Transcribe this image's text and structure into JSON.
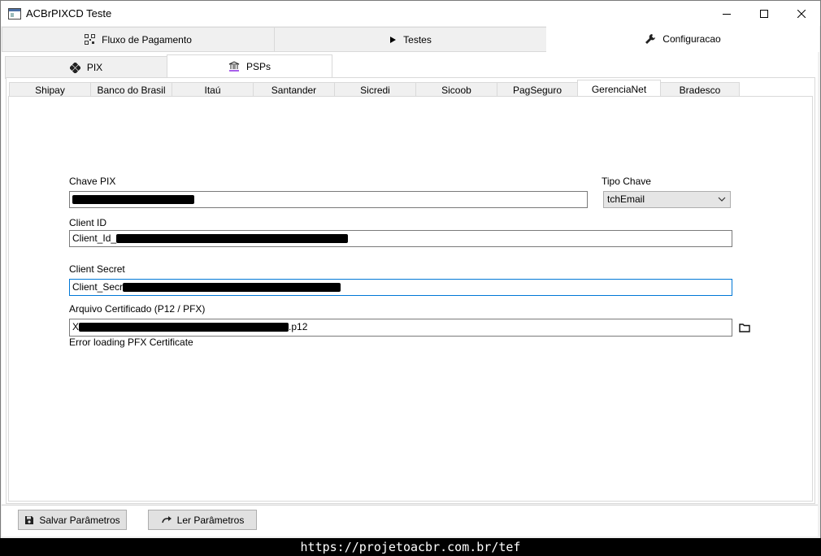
{
  "window": {
    "title": "ACBrPIXCD Teste"
  },
  "top_tabs": [
    {
      "label": "Fluxo de Pagamento",
      "icon": "qr-code-icon"
    },
    {
      "label": "Testes",
      "icon": "play-icon"
    },
    {
      "label": "Configuracao",
      "icon": "wrench-icon"
    }
  ],
  "config_tabs": [
    {
      "label": "PIX",
      "icon": "pix-logo-icon"
    },
    {
      "label": "PSPs",
      "icon": "bank-icon"
    }
  ],
  "psp_tabs": [
    "Shipay",
    "Banco do Brasil",
    "Itaú",
    "Santander",
    "Sicredi",
    "Sicoob",
    "PagSeguro",
    "GerenciaNet",
    "Bradesco"
  ],
  "active_psp": "GerenciaNet",
  "form": {
    "chave_pix_label": "Chave PIX",
    "tipo_chave_label": "Tipo Chave",
    "tipo_chave_value": "tchEmail",
    "client_id_label": "Client ID",
    "client_id_prefix": "Client_Id_",
    "client_secret_label": "Client Secret",
    "client_secret_prefix": "Client_Secr",
    "arquivo_label": "Arquivo Certificado (P12 / PFX)",
    "arquivo_prefix": "X",
    "arquivo_suffix": ".p12",
    "error_text": "Error loading PFX Certificate"
  },
  "buttons": {
    "salvar": "Salvar Parâmetros",
    "ler": "Ler Parâmetros"
  },
  "footer": {
    "url": "https://projetoacbr.com.br/tef"
  },
  "colors": {
    "focus": "#0078d7",
    "pix_accent": "#32bcad"
  }
}
